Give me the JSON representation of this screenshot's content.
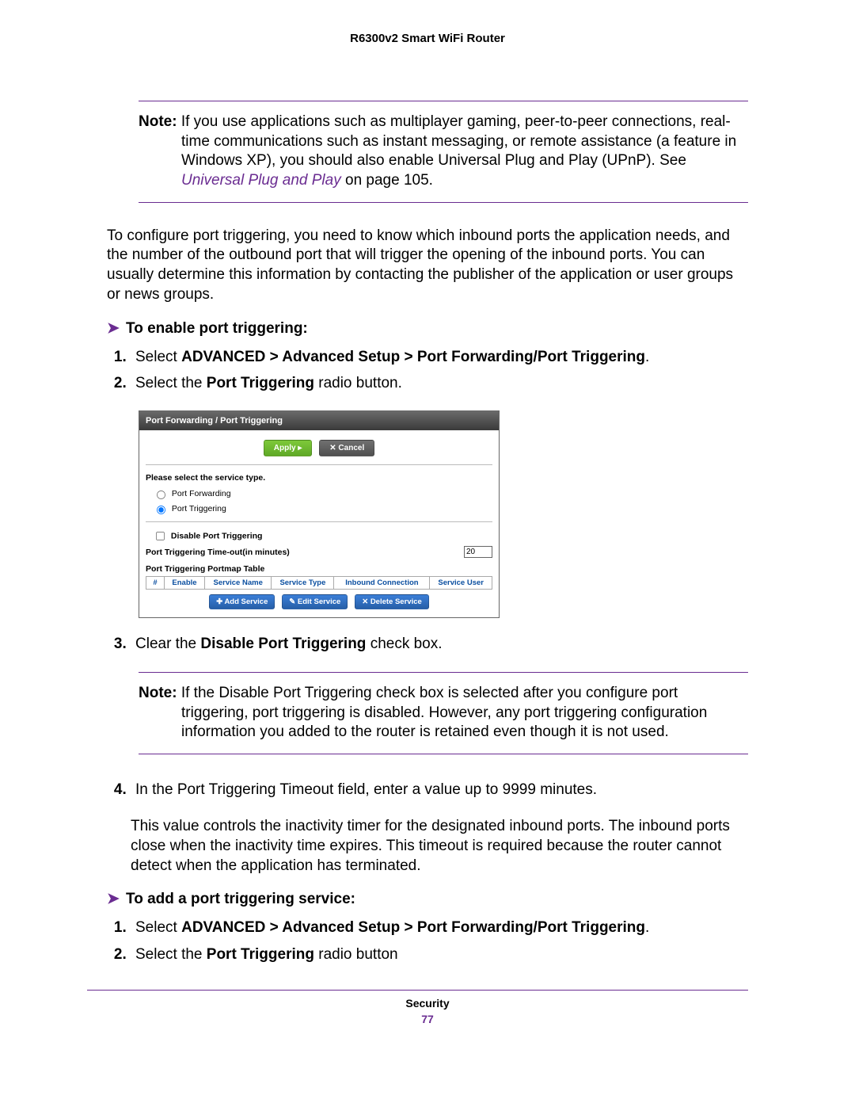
{
  "header": {
    "title": "R6300v2 Smart WiFi Router"
  },
  "note1": {
    "label": "Note:",
    "text_a": "If you use applications such as multiplayer gaming, peer-to-peer connections, real-time communications such as instant messaging, or remote assistance (a feature in Windows XP), you should also enable Universal Plug and Play (UPnP). See ",
    "link": "Universal Plug and Play",
    "text_b": " on page 105."
  },
  "para_intro": "To configure port triggering, you need to know which inbound ports the application needs, and the number of the outbound port that will trigger the opening of the inbound ports. You can usually determine this information by contacting the publisher of the application or user groups or news groups.",
  "proc1": {
    "heading": "To enable port triggering:",
    "step1_a": "Select ",
    "step1_b": "ADVANCED > Advanced Setup > Port Forwarding/Port Triggering",
    "step1_c": ".",
    "step2_a": "Select the ",
    "step2_b": "Port Triggering",
    "step2_c": " radio button.",
    "step3_a": "Clear the ",
    "step3_b": "Disable Port Triggering",
    "step3_c": " check box.",
    "step4": "In the Port Triggering Timeout field, enter a value up to 9999 minutes.",
    "step4_cont": "This value controls the inactivity timer for the designated inbound ports. The inbound ports close when the inactivity time expires. This timeout is required because the router cannot detect when the application has terminated."
  },
  "shot": {
    "title": "Port Forwarding / Port Triggering",
    "btn_apply": "Apply ▸",
    "btn_cancel": "✕ Cancel",
    "svc_label": "Please select the service type.",
    "radio_pf": "Port Forwarding",
    "radio_pt": "Port Triggering",
    "chk_disable": "Disable Port Triggering",
    "timeout_label": "Port Triggering Time-out(in minutes)",
    "timeout_value": "20",
    "tbl_label": "Port Triggering Portmap Table",
    "cols": [
      "#",
      "Enable",
      "Service Name",
      "Service Type",
      "Inbound Connection",
      "Service User"
    ],
    "btn_add": "✚ Add Service",
    "btn_edit": "✎ Edit Service",
    "btn_del": "✕ Delete Service"
  },
  "note2": {
    "label": "Note:",
    "text": "If the Disable Port Triggering check box is selected after you configure port triggering, port triggering is disabled. However, any port triggering configuration information you added to the router is retained even though it is not used."
  },
  "proc2": {
    "heading": "To add a port triggering service:",
    "step1_a": "Select ",
    "step1_b": "ADVANCED > Advanced Setup > Port Forwarding/Port Triggering",
    "step1_c": ".",
    "step2_a": "Select the ",
    "step2_b": "Port Triggering",
    "step2_c": " radio button"
  },
  "footer": {
    "section": "Security",
    "page": "77"
  }
}
